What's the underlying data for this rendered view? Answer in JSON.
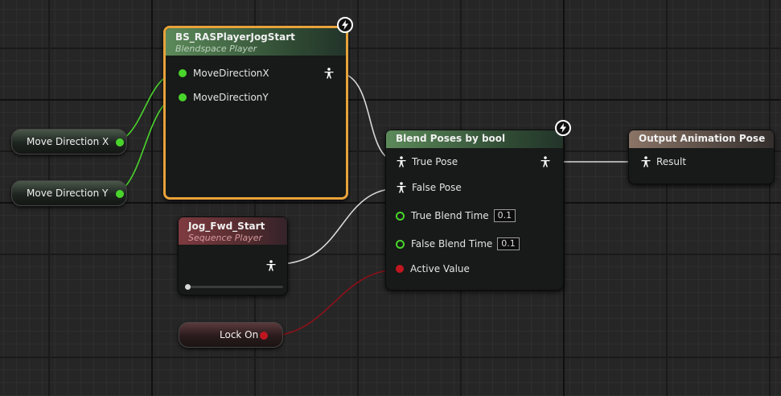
{
  "nodes": {
    "blendspace": {
      "title": "BS_RASPlayerJogStart",
      "subtitle": "Blendspace Player",
      "pins": {
        "x": "MoveDirectionX",
        "y": "MoveDirectionY"
      }
    },
    "blend_poses": {
      "title": "Blend Poses by bool",
      "pins": {
        "true_pose": "True Pose",
        "false_pose": "False Pose",
        "true_blend_time": "True Blend Time",
        "true_blend_value": "0.1",
        "false_blend_time": "False Blend Time",
        "false_blend_value": "0.1",
        "active_value": "Active Value"
      }
    },
    "sequence": {
      "title": "Jog_Fwd_Start",
      "subtitle": "Sequence Player",
      "position_fraction": 0
    },
    "output": {
      "title": "Output Animation Pose",
      "result": "Result"
    }
  },
  "variables": {
    "move_x": "Move Direction X",
    "move_y": "Move Direction Y",
    "lock_on": "Lock On"
  },
  "colors": {
    "float_pin": "#49d52b",
    "bool_pin": "#c0161f",
    "pose_wire": "#d8d8d8",
    "selection": "#e8a23a"
  },
  "icons": {
    "pose": "person-pose-icon",
    "fast_path": "lightning-bolt-icon"
  }
}
